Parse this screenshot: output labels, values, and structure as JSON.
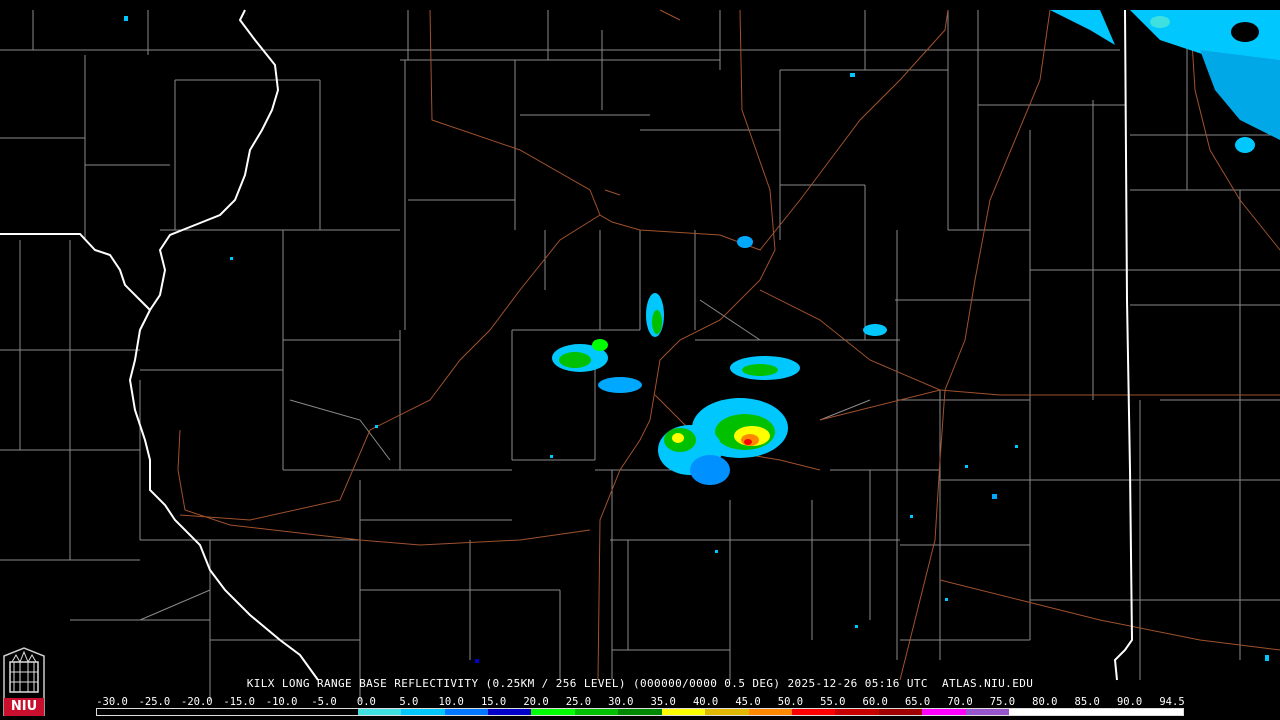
{
  "caption": "KILX LONG RANGE BASE REFLECTIVITY (0.25KM / 256 LEVEL) (000000/0000 0.5 DEG) 2025-12-26 05:16 UTC  ATLAS.NIU.EDU",
  "logo_text": "NIU",
  "scale_labels": [
    "-30.0",
    "-25.0",
    "-20.0",
    "-15.0",
    "-10.0",
    "-5.0",
    "0.0",
    "5.0",
    "10.0",
    "15.0",
    "20.0",
    "25.0",
    "30.0",
    "35.0",
    "40.0",
    "45.0",
    "50.0",
    "55.0",
    "60.0",
    "65.0",
    "70.0",
    "75.0",
    "80.0",
    "85.0",
    "90.0",
    "94.5"
  ],
  "scale_colors": [
    "#000000",
    "#000000",
    "#000000",
    "#000000",
    "#000000",
    "#000000",
    "#40e0e0",
    "#00c8ff",
    "#0078ff",
    "#0000c8",
    "#00ff00",
    "#00c000",
    "#008800",
    "#ffff00",
    "#e0b800",
    "#ff8800",
    "#ff0000",
    "#c80000",
    "#a00000",
    "#ff00ff",
    "#9955cc",
    "#ffffff",
    "#ffffff",
    "#ffffff",
    "#ffffff"
  ],
  "colors": {
    "county_lines": "#8a8a8a",
    "state_lines": "#ffffff",
    "highways": "#a0522d",
    "background": "#000000"
  }
}
